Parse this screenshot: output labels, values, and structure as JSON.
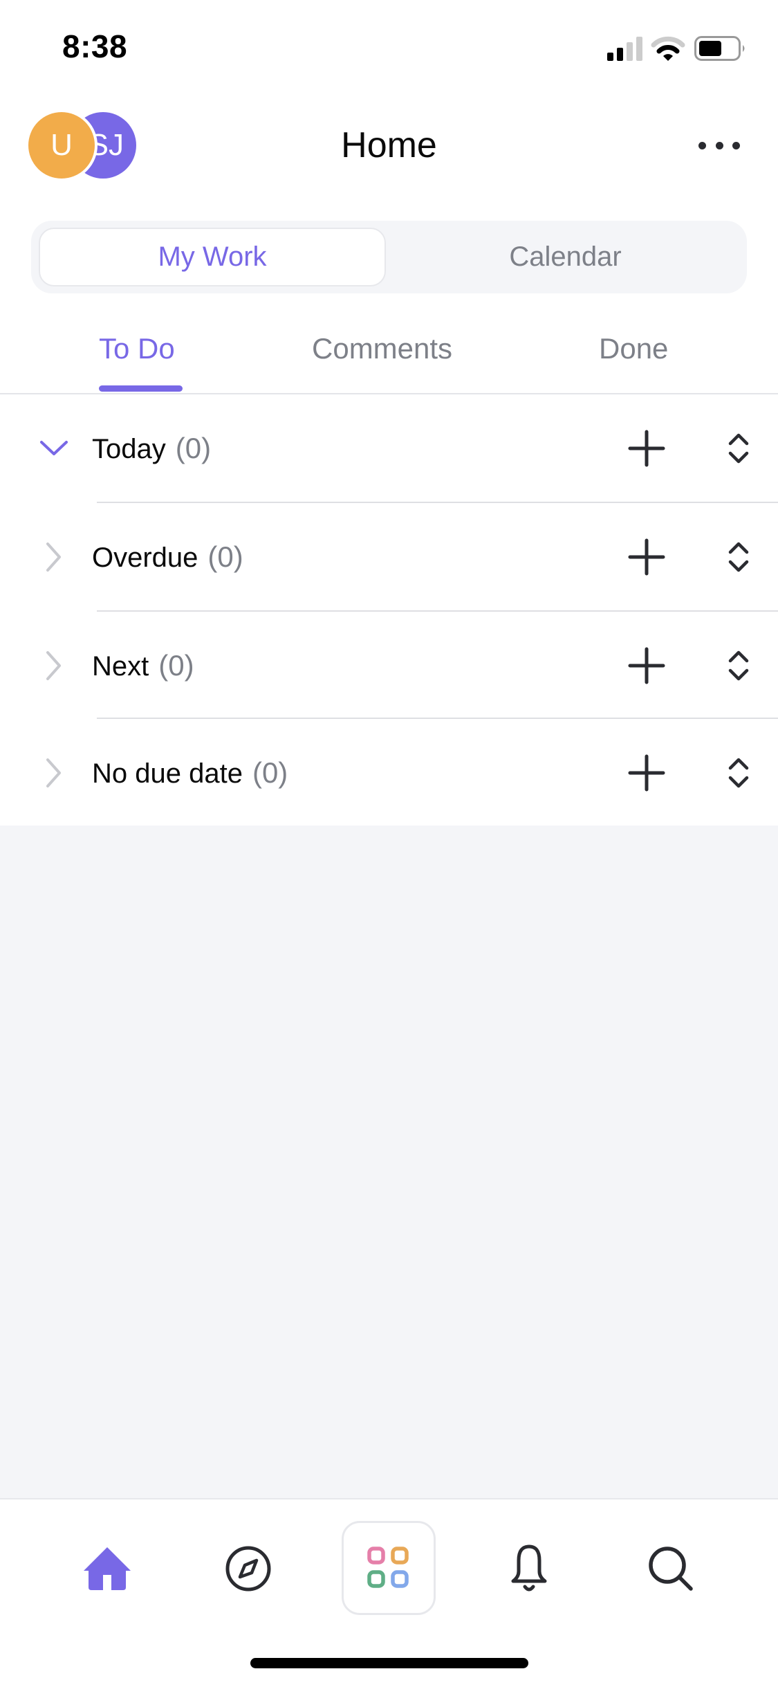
{
  "status_bar": {
    "time": "8:38",
    "signal_bars": 2,
    "signal_bars_total": 4,
    "wifi_strength": 2,
    "wifi_strength_total": 3,
    "battery_level": 0.6
  },
  "header": {
    "title": "Home",
    "avatars": [
      {
        "initials": "U",
        "color": "#f2ac4a"
      },
      {
        "initials": "SJ",
        "color": "#7868e6"
      }
    ],
    "more_icon": "more-horizontal-icon"
  },
  "segmented_control": {
    "options": [
      {
        "label": "My Work",
        "selected": true
      },
      {
        "label": "Calendar",
        "selected": false
      }
    ]
  },
  "tabs": [
    {
      "label": "To Do",
      "active": true
    },
    {
      "label": "Comments",
      "active": false
    },
    {
      "label": "Done",
      "active": false
    }
  ],
  "sections": [
    {
      "label": "Today",
      "count": "(0)",
      "expanded": true
    },
    {
      "label": "Overdue",
      "count": "(0)",
      "expanded": false
    },
    {
      "label": "Next",
      "count": "(0)",
      "expanded": false
    },
    {
      "label": "No due date",
      "count": "(0)",
      "expanded": false
    }
  ],
  "bottom_nav": [
    {
      "name": "home",
      "icon": "home-icon",
      "active": true
    },
    {
      "name": "explore",
      "icon": "compass-icon",
      "active": false
    },
    {
      "name": "apps",
      "icon": "apps-grid-icon",
      "active": false
    },
    {
      "name": "notifications",
      "icon": "bell-icon",
      "active": false
    },
    {
      "name": "search",
      "icon": "search-icon",
      "active": false
    }
  ],
  "colors": {
    "accent": "#7868e6",
    "text_primary": "#0a0a0a",
    "text_secondary": "#7d8088",
    "background": "#f4f5f8",
    "apps_pink": "#e57fa9",
    "apps_orange": "#e8a857",
    "apps_green": "#5fae86",
    "apps_blue": "#82a8ea"
  }
}
